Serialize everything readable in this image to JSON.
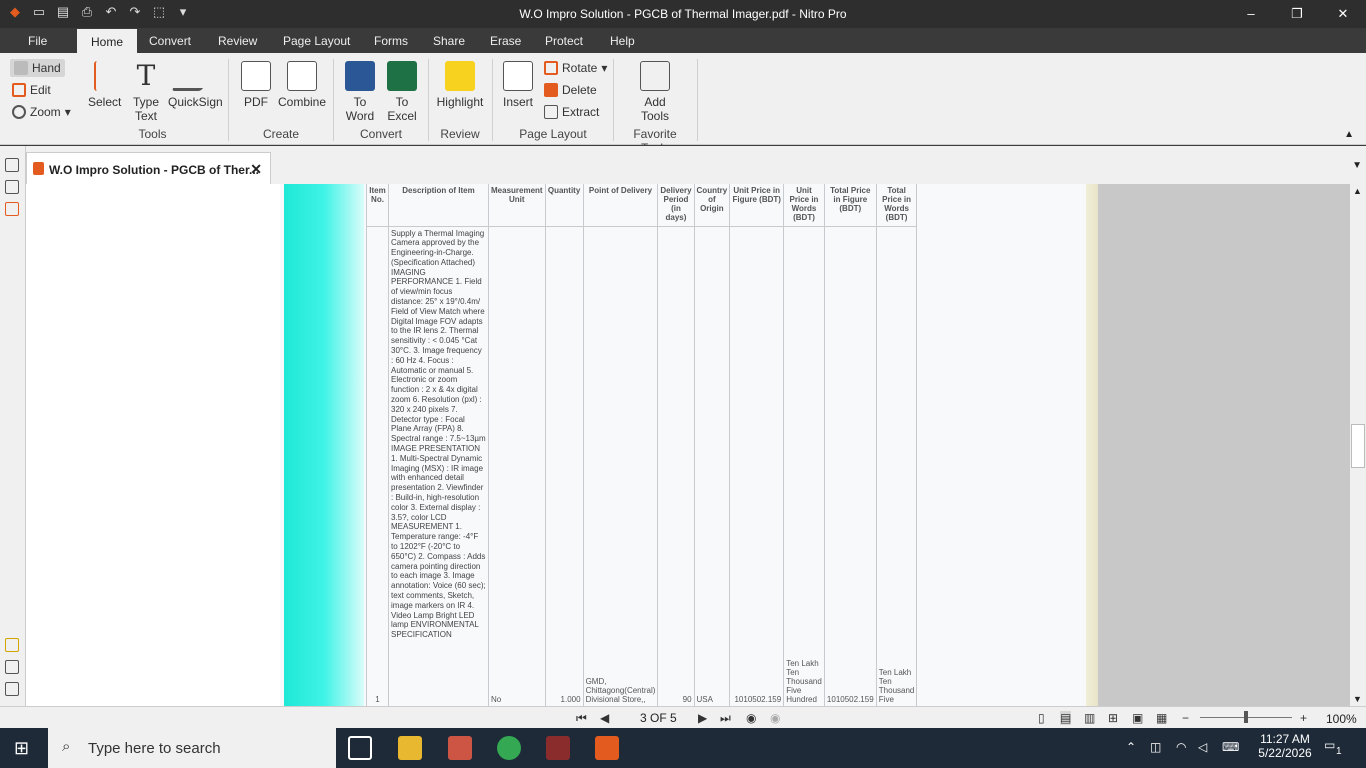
{
  "window": {
    "title": "W.O Impro Solution - PGCB of Thermal Imager.pdf - Nitro Pro",
    "minimize": "–",
    "restore": "❐",
    "close": "✕"
  },
  "menu": {
    "tabs": [
      "File",
      "Home",
      "Convert",
      "Review",
      "Page Layout",
      "Forms",
      "Share",
      "Erase",
      "Protect",
      "Help"
    ],
    "active": "Home"
  },
  "ribbon": {
    "tools_group": "Tools",
    "create_group": "Create",
    "convert_group": "Convert",
    "review_group": "Review",
    "page_layout_group": "Page Layout",
    "favorite_group": "Favorite Tools",
    "hand": "Hand",
    "edit": "Edit",
    "zoom": "Zoom",
    "select": "Select",
    "type_text": [
      "Type",
      "Text"
    ],
    "quicksign": "QuickSign",
    "pdf": "PDF",
    "combine": "Combine",
    "to_word": [
      "To",
      "Word"
    ],
    "to_excel": [
      "To",
      "Excel"
    ],
    "highlight": "Highlight",
    "insert": "Insert",
    "rotate": "Rotate",
    "delete": "Delete",
    "extract": "Extract",
    "add_tools": [
      "Add",
      "Tools"
    ]
  },
  "document_tab": {
    "title": "W.O Impro Solution - PGCB of Ther...",
    "close": "✕"
  },
  "table": {
    "headers": [
      "Item No.",
      "Description of Item",
      "Measurement Unit",
      "Quantity",
      "Point of Delivery",
      "Delivery Period (in days)",
      "Country of Origin",
      "Unit Price in Figure (BDT)",
      "Unit Price in Words (BDT)",
      "Total Price in Figure (BDT)",
      "Total Price in Words (BDT)"
    ],
    "description": "Supply a Thermal Imaging Camera approved by the Engineering-in-Charge. (Specification Attached) IMAGING PERFORMANCE 1. Field of view/min focus distance: 25° x 19°/0.4m/ Field of View Match where Digital Image FOV adapts to the IR lens 2. Thermal sensitivity : < 0.045 °Cat 30°C. 3. Image frequency : 60 Hz 4. Focus : Automatic or manual 5. Electronic or zoom function : 2 x & 4x digital zoom 6. Resolution (pxl) : 320 x 240 pixels 7. Detector type : Focal Plane Array (FPA) 8. Spectral range : 7.5~13µm IMAGE PRESENTATION 1. Multi-Spectral Dynamic Imaging (MSX) : IR image with enhanced detail presentation 2. Viewfinder : Build-in, high-resolution color 3. External display : 3.5?, color LCD MEASUREMENT 1. Temperature range: -4°F to 1202°F (-20°C to 650°C) 2. Compass : Adds camera pointing direction to each image 3. Image annotation: Voice (60 sec); text comments, Sketch, image markers on IR 4. Video Lamp Bright LED lamp ENVIRONMENTAL SPECIFICATION",
    "item_no": "1",
    "unit": "No",
    "quantity": "1.000",
    "delivery_point": "GMD, Chittagong(Central) Divisional Store,,",
    "period": "90",
    "country": "USA",
    "unit_price": "1010502.159",
    "unit_words": "Ten Lakh Ten Thousand Five Hundred",
    "total_price": "1010502.159",
    "total_words": "Ten Lakh Ten Thousand Five"
  },
  "status": {
    "page": "3 OF 5",
    "zoom": "100%"
  },
  "taskbar": {
    "search_placeholder": "Type here to search",
    "time": "11:27 AM",
    "date": "5/22/2026",
    "notifications": "1"
  }
}
